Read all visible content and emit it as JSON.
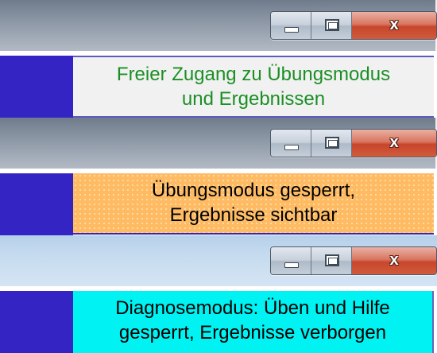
{
  "panels": [
    {
      "title_bar": {
        "minimize_glyph": "minimize-icon",
        "maximize_glyph": "maximize-icon",
        "close_label": "x"
      },
      "status_text": "Freier Zugang zu Übungsmodus\nund Ergebnissen",
      "status_background": "#f1f1f1",
      "text_color": "#1b8f25"
    },
    {
      "title_bar": {
        "minimize_glyph": "minimize-icon",
        "maximize_glyph": "maximize-icon",
        "close_label": "x"
      },
      "status_text": "Übungsmodus gesperrt,\nErgebnisse sichtbar",
      "status_background": "#ffbb63",
      "text_color": "#000000"
    },
    {
      "title_bar": {
        "minimize_glyph": "minimize-icon",
        "maximize_glyph": "maximize-icon",
        "close_label": "x"
      },
      "status_text": "Diagnosemodus: Üben und Hilfe\ngesperrt, Ergebnisse verborgen",
      "status_background": "#00f2f2",
      "text_color": "#000000"
    }
  ],
  "colors": {
    "accent_stripe": "#3524c4",
    "close_button": "#c7462c"
  }
}
